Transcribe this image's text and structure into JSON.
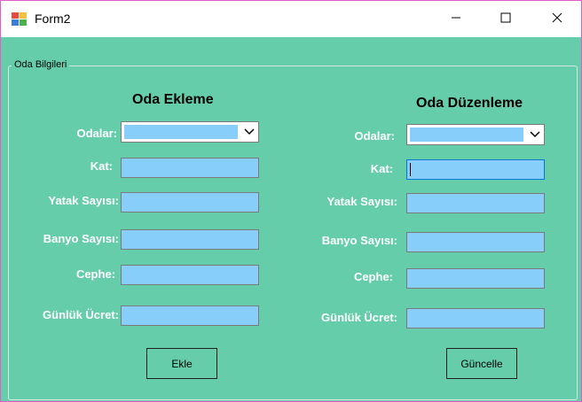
{
  "window": {
    "title": "Form2",
    "accent_color": "#66cdaa",
    "field_color": "#87cefa"
  },
  "groupbox": {
    "label": "Oda Bilgileri"
  },
  "left": {
    "heading": "Oda Ekleme",
    "labels": [
      "Odalar:",
      "Kat:",
      "Yatak Sayısı:",
      "Banyo Sayısı:",
      "Cephe:",
      "Günlük Ücret:"
    ],
    "button": "Ekle"
  },
  "right": {
    "heading": "Oda Düzenleme",
    "labels": [
      "Odalar:",
      "Kat:",
      "Yatak Sayısı:",
      "Banyo Sayısı:",
      "Cephe:",
      "Günlük Ücret:"
    ],
    "button": "Güncelle"
  },
  "icons": [
    "app-icon",
    "minimize-icon",
    "maximize-icon",
    "close-icon",
    "chevron-down-icon"
  ]
}
